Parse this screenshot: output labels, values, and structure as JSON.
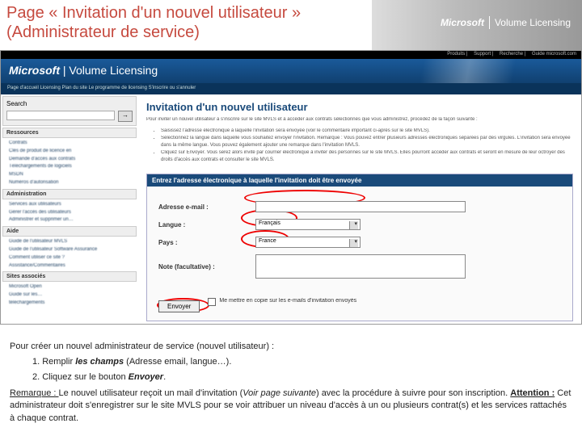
{
  "slide": {
    "title_line1": "Page « Invitation d'un nouvel utilisateur »",
    "title_line2": " (Administrateur de service)",
    "brand_ms": "Microsoft",
    "brand_vl": "Volume Licensing"
  },
  "topnav": {
    "i1": "Produits",
    "i2": "Support",
    "i3": "Recherche",
    "i4": "Guide microsoft.com"
  },
  "bluebar": {
    "brand_ms": "Microsoft",
    "brand_vl": "Volume Licensing",
    "sub": "Page d'accueil Licensing    Plan du site    Le programme de licensing S'inscrire ou s'annuler"
  },
  "leftnav": {
    "search": "Search",
    "h1": "Ressources",
    "i1a": "Contrats",
    "i1b": "Clés de produit de licence en",
    "i1c": "Demande d'accès aux contrats",
    "i1d": "Téléchargements de logiciels",
    "i1e": "MSDN",
    "i1f": "Numéros d'autorisation",
    "h2": "Administration",
    "i2a": "Services aux utilisateurs",
    "i2b": "Gérer l'accès des utilisateurs",
    "i2c": "Administrer et supprimer un…",
    "h3": "Aide",
    "i3a": "Guide de l'utilisateur MVLS",
    "i3b": "Guide de l'utilisateur Software Assurance",
    "i3c": "Comment utiliser ce site ?",
    "i3d": "Assistance/Commentaires",
    "h4": "Sites associés",
    "i4a": "Microsoft Open",
    "i4b": "Guide sur les…",
    "i4c": "téléchargements"
  },
  "main": {
    "heading": "Invitation d'un nouvel utilisateur",
    "intro": "Pour inviter un nouvel utilisateur à s'inscrire sur le site MVLS et à accéder aux contrats sélectionnés que vous administrez, procédez de la façon suivante :",
    "b1": "Saisissez l'adresse électronique à laquelle l'invitation sera envoyée (voir le commentaire important ci-après sur le site MVLS).",
    "b2": "Sélectionnez la langue dans laquelle vous souhaitez envoyer l'invitation. Remarque : Vous pouvez entrer plusieurs adresses électroniques séparées par des virgules. L'invitation sera envoyée dans la même langue. Vous pouvez également ajouter une remarque dans l'invitation MVLS.",
    "b3": "Cliquez sur Envoyer. Vous serez alors invité par courrier électronique à inviter des personnes sur le site MVLS. Elles pourront accéder aux contrats et seront en mesure de leur octroyer des droits d'accès aux contrats et consulter le site MVLS.",
    "form_header": "Entrez l'adresse électronique à laquelle l'invitation doit être envoyée",
    "f_email": "Adresse e-mail :",
    "f_lang": "Langue :",
    "v_lang": "Français",
    "f_country": "Pays :",
    "v_country": "France",
    "f_note": "Note (facultative) :",
    "submit": "Envoyer",
    "chk": "Me mettre en copie sur les e-mails d'invitation envoyés"
  },
  "footer": {
    "p1": "Pour créer un nouvel administrateur de service (nouvel utilisateur) :",
    "s1a": "1. Remplir ",
    "s1b": "les champs",
    "s1c": " (Adresse email, langue…).",
    "s2a": "2. Cliquez sur le bouton ",
    "s2b": "Envoyer",
    "s2c": ".",
    "r1": "Remarque : ",
    "r2": "Le nouvel utilisateur reçoit un mail d'invitation (",
    "r3": "Voir page suivante",
    "r4": ") avec la procédure à suivre pour son inscription. ",
    "r5": "Attention :",
    "r6": " Cet administrateur doit s'enregistrer sur le site MVLS pour se voir attribuer un niveau d'accès à un ou plusieurs contrat(s) et les services rattachés à chaque contrat."
  }
}
